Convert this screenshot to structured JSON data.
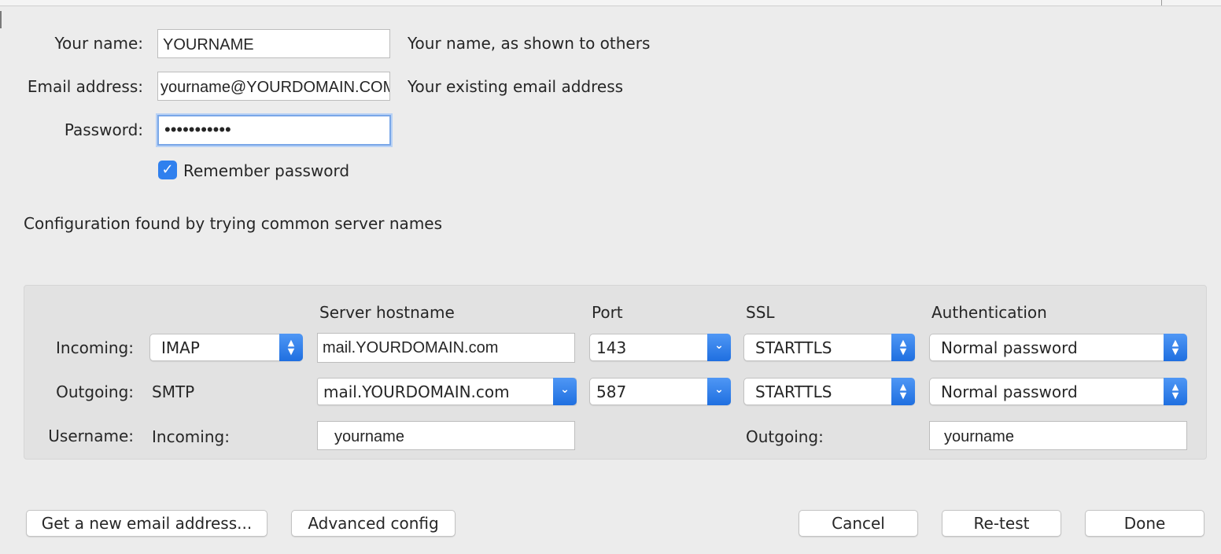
{
  "identity": {
    "name_label": "Your name:",
    "name_value": "YOURNAME",
    "name_hint": "Your name, as shown to others",
    "email_label": "Email address:",
    "email_value": "yourname@YOURDOMAIN.COM",
    "email_hint": "Your existing email address",
    "password_label": "Password:",
    "password_mask": "•••••••••••",
    "remember_label": "Remember password",
    "remember_checked": true
  },
  "status_text": "Configuration found by trying common server names",
  "server_config": {
    "headers": {
      "hostname": "Server hostname",
      "port": "Port",
      "ssl": "SSL",
      "auth": "Authentication"
    },
    "incoming": {
      "label": "Incoming:",
      "protocol": "IMAP",
      "hostname": "mail.YOURDOMAIN.com",
      "port": "143",
      "ssl": "STARTTLS",
      "auth": "Normal password"
    },
    "outgoing": {
      "label": "Outgoing:",
      "protocol": "SMTP",
      "hostname": "mail.YOURDOMAIN.com",
      "port": "587",
      "ssl": "STARTTLS",
      "auth": "Normal password"
    },
    "username": {
      "label": "Username:",
      "incoming_label": "Incoming:",
      "incoming_value": "yourname",
      "outgoing_label": "Outgoing:",
      "outgoing_value": "yourname"
    }
  },
  "buttons": {
    "new_email": "Get a new email address...",
    "advanced": "Advanced config",
    "cancel": "Cancel",
    "retest": "Re-test",
    "done": "Done"
  },
  "colors": {
    "accent": "#2f80ee",
    "background": "#ececec",
    "panel": "#e2e2e2"
  }
}
